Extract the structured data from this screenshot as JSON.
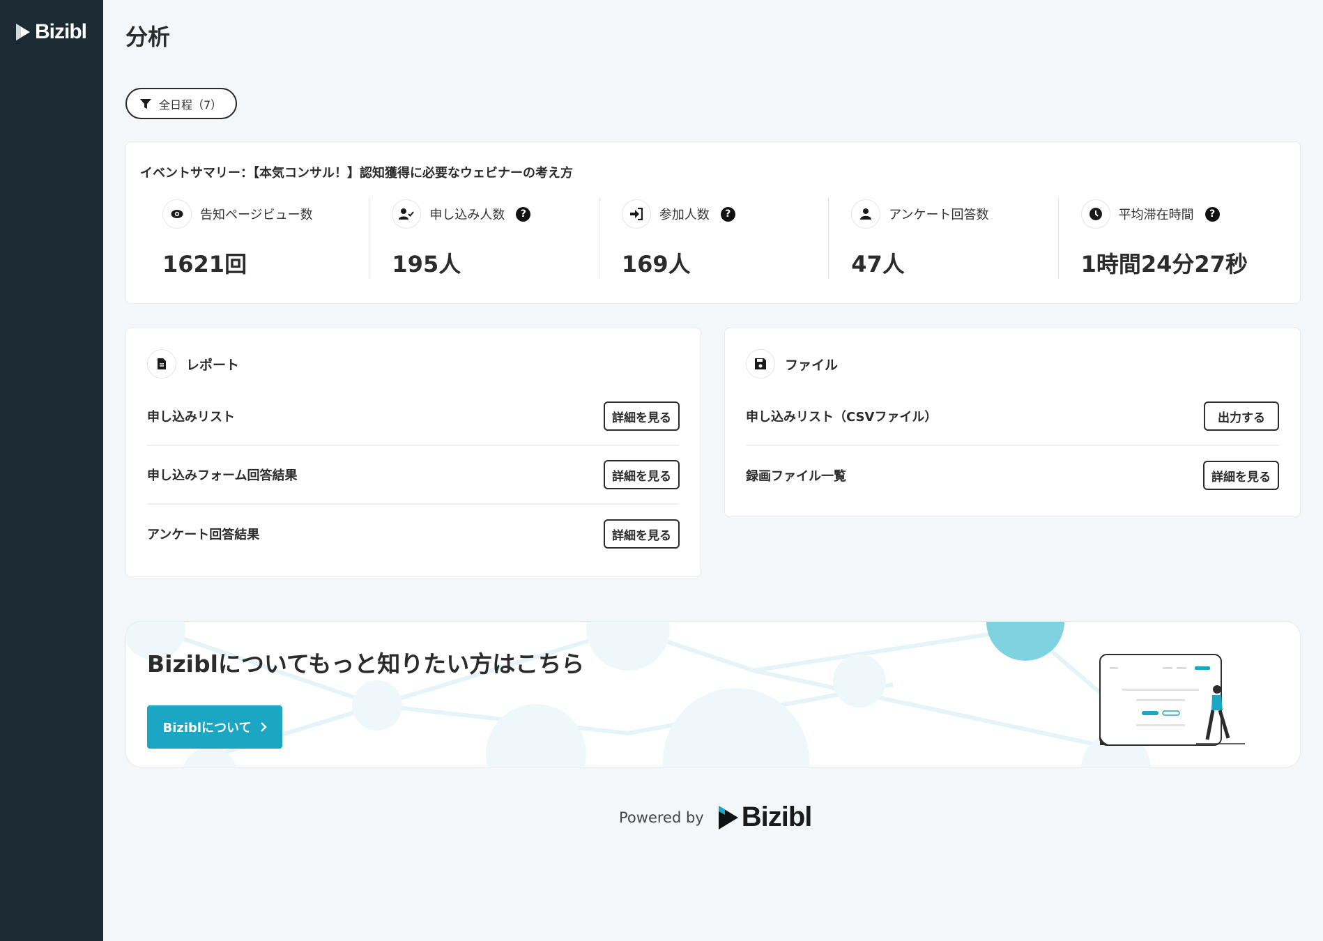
{
  "sidebar": {
    "logo_text": "Bizibl"
  },
  "page": {
    "title": "分析"
  },
  "filter": {
    "label": "全日程（7）",
    "icon": "filter-icon"
  },
  "summary": {
    "title": "イベントサマリー：【本気コンサル！】認知獲得に必要なウェビナーの考え方",
    "stats": [
      {
        "icon": "eye-icon",
        "label": "告知ページビュー数",
        "help": false,
        "value": "1621回"
      },
      {
        "icon": "user-check-icon",
        "label": "申し込み人数",
        "help": true,
        "value": "195人"
      },
      {
        "icon": "sign-in-icon",
        "label": "参加人数",
        "help": true,
        "value": "169人"
      },
      {
        "icon": "user-icon",
        "label": "アンケート回答数",
        "help": false,
        "value": "47人"
      },
      {
        "icon": "clock-icon",
        "label": "平均滞在時間",
        "help": true,
        "value": "1時間24分27秒"
      }
    ],
    "help_glyph": "?"
  },
  "report": {
    "title": "レポート",
    "rows": [
      {
        "label": "申し込みリスト",
        "button": "詳細を見る"
      },
      {
        "label": "申し込みフォーム回答結果",
        "button": "詳細を見る"
      },
      {
        "label": "アンケート回答結果",
        "button": "詳細を見る"
      }
    ]
  },
  "file": {
    "title": "ファイル",
    "rows": [
      {
        "label": "申し込みリスト（CSVファイル）",
        "button": "出力する"
      },
      {
        "label": "録画ファイル一覧",
        "button": "詳細を見る"
      }
    ]
  },
  "banner": {
    "title": "Biziblについてもっと知りたい方はこちら",
    "button": "Biziblについて"
  },
  "footer": {
    "powered_by": "Powered by",
    "logo_text": "Bizibl"
  },
  "colors": {
    "sidebar": "#1c2b33",
    "accent": "#1ba7c4",
    "background": "#f4f7fa"
  }
}
